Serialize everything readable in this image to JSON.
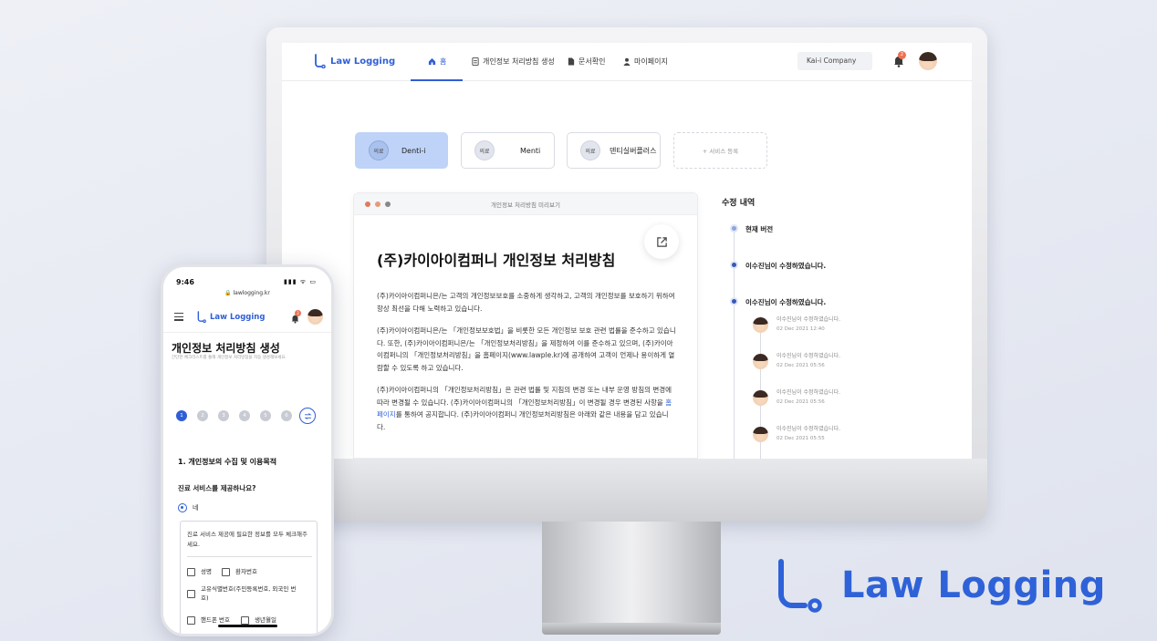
{
  "desktop": {
    "logo": "Law Logging",
    "nav": [
      {
        "label": "홈",
        "icon": "home-icon"
      },
      {
        "label": "개인정보 처리방침 생성",
        "icon": "document-icon"
      },
      {
        "label": "문서확인",
        "icon": "file-icon"
      },
      {
        "label": "마이페이지",
        "icon": "user-icon"
      }
    ],
    "company": "Kai-i Company",
    "notification_count": "2",
    "services": [
      {
        "badge": "의료",
        "label": "Denti-i"
      },
      {
        "badge": "의료",
        "label": "Menti"
      },
      {
        "badge": "의료",
        "label": "덴티실버플러스"
      }
    ],
    "add_service": "+ 서비스 등록",
    "preview": {
      "bar_title": "개인정보 처리방침 미리보기",
      "title": "(주)카이아이컴퍼니 개인정보 처리방침",
      "para1": "(주)카이아이컴퍼니은/는 고객의 개인정보보호를 소중하게 생각하고, 고객의 개인정보를 보호하기 위하여 항상 최선을 다해 노력하고 있습니다.",
      "para2": "(주)카이아이컴퍼니은/는 「개인정보보호법」을 비롯한 모든 개인정보 보호 관련 법률을 준수하고 있습니다. 또한, (주)카이아이컴퍼니은/는 「개인정보처리방침」을 제정하여 이를 준수하고 있으며, (주)카이아이컴퍼니의 「개인정보처리방침」을 홈페이지(www.lawple.kr)에 공개하여 고객이 언제나 용이하게 열람할 수 있도록 하고 있습니다.",
      "para3_a": "(주)카이아이컴퍼니의 「개인정보처리방침」은 관련 법률 및 지침의 변경 또는 내부 운영 방침의 변경에 따라 변경될 수 있습니다. (주)카이아이컴퍼니의 「개인정보처리방침」이 변경될 경우 변경된 사항을 ",
      "para3_link": "홈페이지",
      "para3_b": "를 통하여 공지합니다. (주)카이아이컴퍼니 개인정보처리방침은 아래와 같은 내용을 담고 있습니다."
    },
    "history": {
      "title": "수정 내역",
      "current": "현재 버전",
      "events": [
        "이수진님이 수정하였습니다.",
        "이수진님이 수정하였습니다."
      ],
      "entries": [
        {
          "text": "이수진님이 수정하였습니다.",
          "date": "02 Dec 2021 12:40"
        },
        {
          "text": "이수진님이 수정하였습니다.",
          "date": "02 Dec 2021 05:56"
        },
        {
          "text": "이수진님이 수정하였습니다.",
          "date": "02 Dec 2021 05:56"
        },
        {
          "text": "이수진님이 수정하였습니다.",
          "date": "02 Dec 2021 05:55"
        }
      ]
    }
  },
  "mobile": {
    "time": "9:46",
    "status_icons": "▮▮▮ ᯤ ▭",
    "url": "🔒 lawlogging.kr",
    "logo": "Law Logging",
    "notification_count": "2",
    "title": "개인정보 처리방침 생성",
    "description": "간단한 체크리스트를 통해 개인정보 처리방침을 자동 생성해보세요.",
    "steps": [
      "1",
      "2",
      "3",
      "4",
      "5",
      "6"
    ],
    "section": "1. 개인정보의 수집 및 이용목적",
    "question": "진료 서비스를 제공하나요?",
    "answer": "네",
    "box_text": "진료 서비스 제공에 필요한 정보를 모두 체크해주세요.",
    "checks": [
      "성명",
      "환자번호",
      "고유식별번호(주민등록번호, 외국인 번호)",
      "핸드폰 번호",
      "생년월일"
    ]
  },
  "brand": "Law Logging",
  "colors": {
    "primary": "#2f5fd6",
    "active_card": "#bed3f7",
    "notification": "#ee7152"
  }
}
